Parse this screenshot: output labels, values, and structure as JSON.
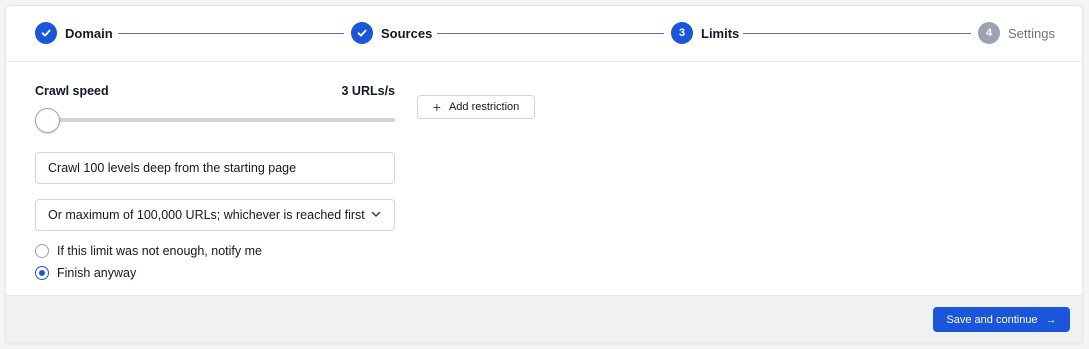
{
  "stepper": {
    "steps": [
      {
        "label": "Domain",
        "state": "done",
        "number": ""
      },
      {
        "label": "Sources",
        "state": "done",
        "number": ""
      },
      {
        "label": "Limits",
        "state": "active",
        "number": "3"
      },
      {
        "label": "Settings",
        "state": "pending",
        "number": "4"
      }
    ]
  },
  "limits": {
    "crawl_speed_label": "Crawl speed",
    "crawl_speed_value": "3 URLs/s",
    "crawl_speed_slider_level": 0,
    "add_restriction_label": "Add restriction",
    "depth_input_value": "Crawl 100 levels deep from the starting page",
    "max_urls_select_value": "Or maximum of 100,000 URLs; whichever is reached first",
    "radio_options": [
      {
        "label": "If this limit was not enough, notify me",
        "checked": false
      },
      {
        "label": "Finish anyway",
        "checked": true
      }
    ]
  },
  "footer": {
    "save_label": "Save and continue",
    "save_arrow": "→"
  },
  "colors": {
    "accent": "#1a56db",
    "pending": "#9ca3af",
    "footer_bg": "#f0f1f3"
  }
}
